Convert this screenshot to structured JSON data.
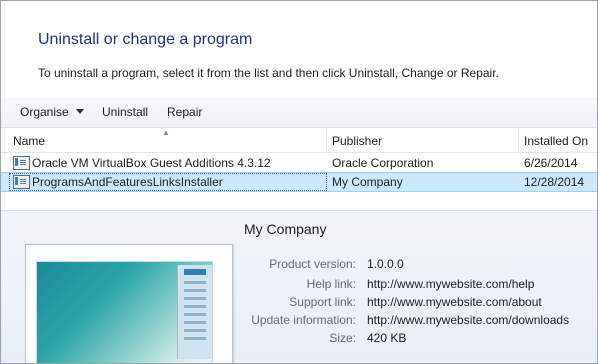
{
  "page": {
    "title": "Uninstall or change a program",
    "subtitle": "To uninstall a program, select it from the list and then click Uninstall, Change or Repair."
  },
  "toolbar": {
    "organise_label": "Organise",
    "uninstall_label": "Uninstall",
    "repair_label": "Repair"
  },
  "table": {
    "columns": [
      "Name",
      "Publisher",
      "Installed On"
    ],
    "rows": [
      {
        "name": "Oracle VM VirtualBox Guest Additions 4.3.12",
        "publisher": "Oracle Corporation",
        "installed": "6/26/2014"
      },
      {
        "name": "ProgramsAndFeaturesLinksInstaller",
        "publisher": "My Company",
        "installed": "12/28/2014"
      }
    ],
    "selected_row": 1
  },
  "details": {
    "company": "My Company",
    "labels": {
      "version": "Product version:",
      "help": "Help link:",
      "support": "Support link:",
      "update": "Update information:",
      "size": "Size:"
    },
    "values": {
      "version": "1.0.0.0",
      "help": "http://www.mywebsite.com/help",
      "support": "http://www.mywebsite.com/about",
      "update": "http://www.mywebsite.com/downloads",
      "size": "420 KB"
    }
  },
  "icons": {
    "program": "program-icon",
    "sort": "sort-ascending-icon",
    "dropdown": "chevron-down-icon"
  },
  "colors": {
    "title": "#1e3287",
    "selection": "#cce8ff",
    "details_bg": "#eef3f9"
  }
}
